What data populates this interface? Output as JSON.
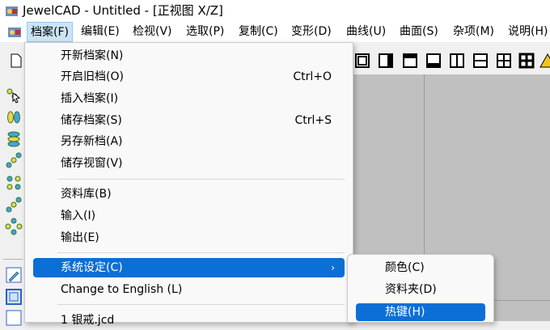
{
  "window": {
    "title": "JewelCAD - Untitled - [正视图 X/Z]"
  },
  "menubar": {
    "items": [
      "档案(F)",
      "编辑(E)",
      "检视(V)",
      "选取(P)",
      "复制(C)",
      "变形(D)",
      "曲线(U)",
      "曲面(S)",
      "杂项(M)",
      "说明(H)"
    ]
  },
  "file_menu": {
    "items": [
      {
        "label": "开新档案(N)",
        "shortcut": ""
      },
      {
        "label": "开启旧档(O)",
        "shortcut": "Ctrl+O"
      },
      {
        "label": "插入档案(I)",
        "shortcut": ""
      },
      {
        "label": "储存档案(S)",
        "shortcut": "Ctrl+S"
      },
      {
        "label": "另存新档(A)",
        "shortcut": ""
      },
      {
        "label": "储存视窗(V)",
        "shortcut": ""
      },
      {
        "label": "资料库(B)",
        "shortcut": ""
      },
      {
        "label": "输入(I)",
        "shortcut": ""
      },
      {
        "label": "输出(E)",
        "shortcut": ""
      },
      {
        "label": "系统设定(C)",
        "shortcut": ""
      },
      {
        "label": "Change to English (L)",
        "shortcut": ""
      },
      {
        "label": "1 银戒.jcd",
        "shortcut": ""
      }
    ]
  },
  "settings_submenu": {
    "items": [
      "颜色(C)",
      "资料夹(D)",
      "热键(H)"
    ]
  },
  "icons": {
    "app": "jewelcad-app-icon",
    "toolbar": [
      "new-file-icon",
      "view-single-icon",
      "view-right-icon",
      "view-top-icon",
      "view-bottom-icon",
      "view-split-vertical-icon",
      "view-split-horizontal-icon",
      "view-quad-icon",
      "view-quad-bold-icon",
      "warning-icon"
    ]
  },
  "colors": {
    "highlight": "#0b6fd6",
    "viewport": "#c0c0c0",
    "menu_bg": "#f9f9f9"
  }
}
